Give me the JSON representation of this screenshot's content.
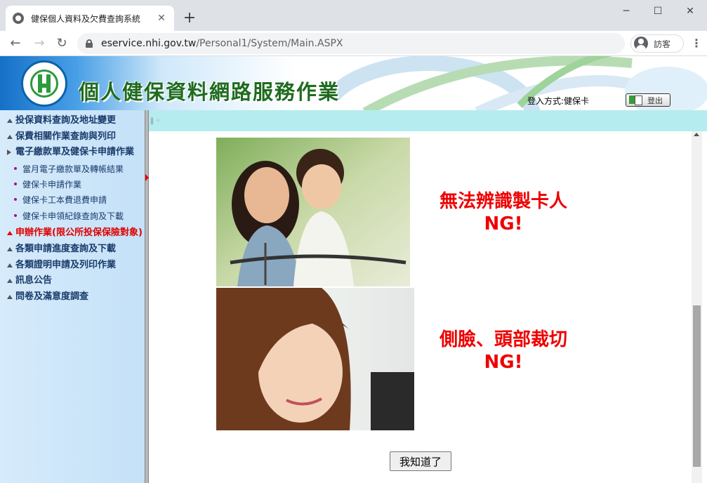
{
  "browser": {
    "tab_title": "健保個人資料及欠費查詢系統",
    "tab_close": "✕",
    "new_tab": "+",
    "url_host": "eservice.nhi.gov.tw",
    "url_path": "/Personal1/System/Main.ASPX",
    "profile_label": "訪客",
    "minimize": "─",
    "maximize": "☐",
    "close": "✕",
    "back": "←",
    "forward": "→",
    "reload": "↻",
    "menu": "⋮"
  },
  "header": {
    "site_title": "個人健保資料網路服務作業",
    "login_method": "登入方式:健保卡",
    "logout_label": "登出"
  },
  "sidebar": {
    "items": [
      {
        "label": "投保資料查詢及地址變更",
        "type": "section"
      },
      {
        "label": "保費相關作業查詢與列印",
        "type": "section"
      },
      {
        "label": "電子繳款單及健保卡申請作業",
        "type": "section-open"
      },
      {
        "label": "當月電子繳款單及轉帳結果",
        "type": "sub"
      },
      {
        "label": "健保卡申請作業",
        "type": "sub"
      },
      {
        "label": "健保卡工本費退費申請",
        "type": "sub"
      },
      {
        "label": "健保卡申領紀錄查詢及下載",
        "type": "sub"
      },
      {
        "label": "申辦作業(限公所投保保險對象)",
        "type": "section-active"
      },
      {
        "label": "各類申請進度查詢及下載",
        "type": "section"
      },
      {
        "label": "各類證明申請及列印作業",
        "type": "section"
      },
      {
        "label": "訊息公告",
        "type": "section"
      },
      {
        "label": "問卷及滿意度調查",
        "type": "section"
      }
    ]
  },
  "main": {
    "top_mark": "‖ ◦",
    "ng1_line1": "無法辨識製卡人",
    "ng1_line2": "NG!",
    "ng2_line1": "側臉、頭部裁切",
    "ng2_line2": "NG!",
    "ok_button": "我知道了"
  },
  "colors": {
    "accent_red": "#ee0000",
    "banner_blue": "#1570c8",
    "title_green": "#1f6b1f",
    "main_top": "#b5ecef"
  }
}
